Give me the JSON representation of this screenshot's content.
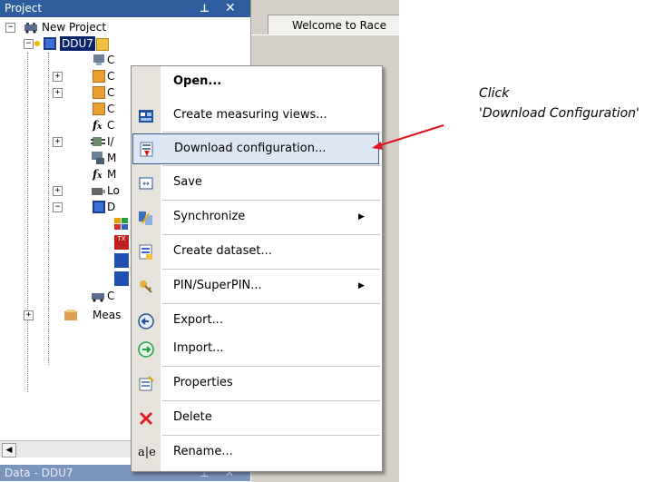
{
  "project_pane": {
    "title": "Project",
    "pin_glyph": "ᵽ",
    "close_glyph": "✕",
    "tree": {
      "root": "New Project",
      "selected": "DDU7",
      "children": [
        {
          "label": "C",
          "icon": "ecu-icon"
        },
        {
          "label": "C",
          "icon": "folder-icon"
        },
        {
          "label": "C",
          "icon": "folder-icon"
        },
        {
          "label": "C",
          "icon": "folder-icon"
        },
        {
          "label": "C",
          "icon": "function-icon"
        },
        {
          "label": "I/",
          "icon": "io-icon"
        },
        {
          "label": "M",
          "icon": "measure-icon"
        },
        {
          "label": "M",
          "icon": "function-icon"
        },
        {
          "label": "Lo",
          "icon": "logger-icon"
        },
        {
          "label": "D",
          "icon": "display-icon"
        },
        {
          "label": "",
          "icon": "colorful-icon"
        },
        {
          "label": "",
          "icon": "tx-icon"
        },
        {
          "label": "",
          "icon": "blue-icon"
        },
        {
          "label": "",
          "icon": "blue-icon"
        },
        {
          "label": "C",
          "icon": "gear-icon"
        }
      ],
      "last_item": "Meas"
    }
  },
  "data_pane": {
    "title": "Data - DDU7",
    "pin_glyph": "ᵽ",
    "close_glyph": "✕"
  },
  "doc_tab": {
    "label": "Welcome to Race"
  },
  "context_menu": {
    "items": [
      {
        "label": "Open...",
        "icon": "",
        "bold": true
      },
      {
        "label": "Create measuring views...",
        "icon": "views-icon"
      },
      {
        "label": "Download configuration...",
        "icon": "download-icon",
        "highlighted": true
      },
      {
        "label": "Save",
        "icon": "save-icon"
      },
      {
        "label": "Synchronize",
        "icon": "sync-icon",
        "submenu": true
      },
      {
        "label": "Create dataset...",
        "icon": "dataset-icon"
      },
      {
        "label": "PIN/SuperPIN...",
        "icon": "key-icon",
        "submenu": true
      },
      {
        "label": "Export...",
        "icon": "export-icon"
      },
      {
        "label": "Import...",
        "icon": "import-icon"
      },
      {
        "label": "Properties",
        "icon": "properties-icon"
      },
      {
        "label": "Delete",
        "icon": "delete-icon"
      },
      {
        "label": "Rename...",
        "icon": "rename-icon"
      }
    ]
  },
  "annotation": {
    "line1": "Click",
    "line2": "'Download Configuration'",
    "arrow_color": "#e0141e"
  },
  "colors": {
    "pane_header": "#2f5e9e",
    "selected_item": "#0a246a",
    "menu_highlight": "#dde6f4",
    "menu_gutter": "#e6e3dc"
  }
}
